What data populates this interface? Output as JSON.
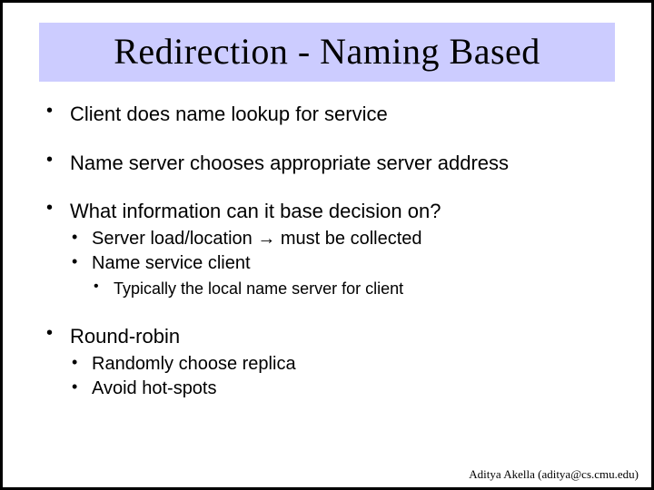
{
  "title": "Redirection - Naming Based",
  "bullets": {
    "b1": "Client does name lookup for service",
    "b2": "Name server chooses appropriate server address",
    "b3": "What information can it base decision on?",
    "b3_1_pre": "Server load/location ",
    "b3_1_arrow": "→",
    "b3_1_post": " must be collected",
    "b3_2": "Name service client",
    "b3_2_1": "Typically the local name server for client",
    "b4": "Round-robin",
    "b4_1": "Randomly choose replica",
    "b4_2": "Avoid hot-spots"
  },
  "footer": "Aditya Akella (aditya@cs.cmu.edu)"
}
